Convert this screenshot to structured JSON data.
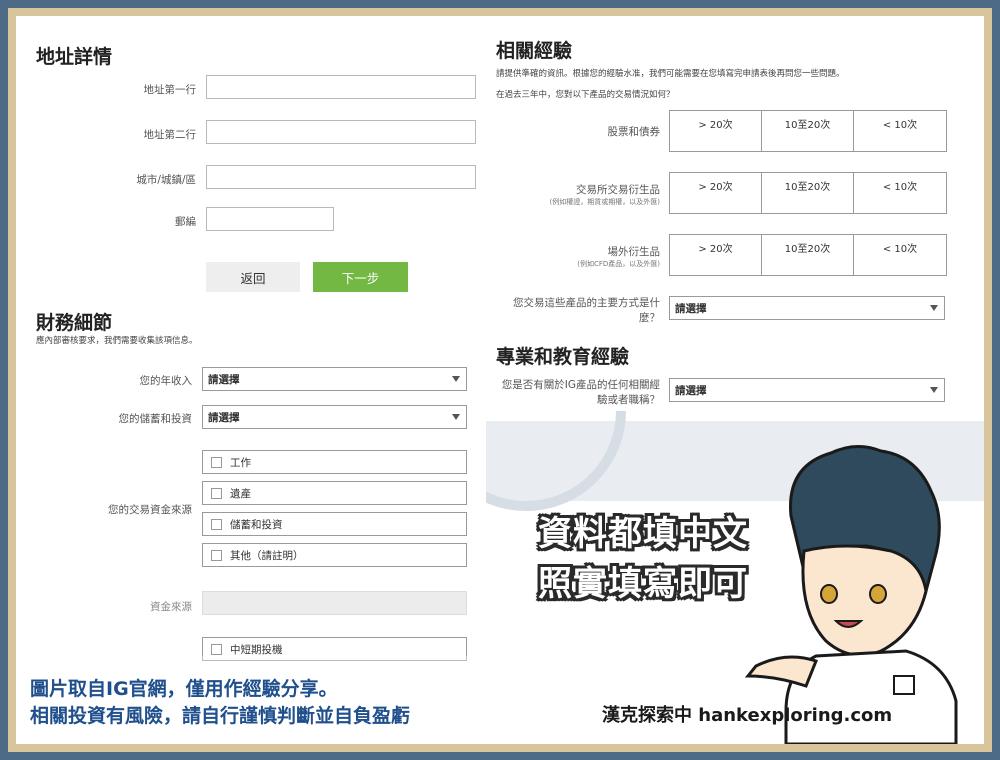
{
  "address": {
    "title": "地址詳情",
    "line1_label": "地址第一行",
    "line2_label": "地址第二行",
    "city_label": "城市/城鎮/區",
    "postcode_label": "郵編",
    "back_label": "返回",
    "next_label": "下一步"
  },
  "finance": {
    "title": "財務細節",
    "subtitle": "應內部審核要求，我們需要收集該項信息。",
    "income_label": "您的年收入",
    "income_value": "請選擇",
    "savings_label": "您的儲蓄和投資",
    "savings_value": "請選擇",
    "source_label": "您的交易資金來源",
    "source_options": [
      "工作",
      "遺產",
      "儲蓄和投資",
      "其他（請註明）"
    ],
    "source_other_label": "資金來源",
    "purpose_option": "中短期投機"
  },
  "experience": {
    "title": "相關經驗",
    "subtitle": "請提供準確的資訊。根據您的經驗水准，我們可能需要在您填寫完申請表後再問您一些問題。",
    "question": "在過去三年中，您對以下產品的交易情況如何？",
    "rows": [
      {
        "label": "股票和債券",
        "note": ""
      },
      {
        "label": "交易所交易衍生品",
        "note": "(例如權證，期貨或期權，以及外匯)"
      },
      {
        "label": "場外衍生品",
        "note": "(例如CFD產品，以及外匯)"
      }
    ],
    "freq_options": [
      "> 20次",
      "10至20次",
      "< 10次"
    ],
    "method_label": "您交易這些產品的主要方式是什麼？",
    "method_value": "請選擇"
  },
  "education": {
    "title": "專業和教育經驗",
    "question": "您是否有關於IG產品的任何相關經驗或者職稱？",
    "value": "請選擇"
  },
  "overlay": {
    "line1": "資料都填中文",
    "line2": "照實填寫即可",
    "footer_line1": "圖片取自IG官網，僅用作經驗分享。",
    "footer_line2": "相關投資有風險，請自行謹慎判斷並自負盈虧",
    "brand": "漢克探索中 hankexploring.com"
  },
  "colors": {
    "frame": "#4d6b86",
    "border": "#d9c59b",
    "next_button": "#73b843",
    "footer_text": "#1f4f8c"
  }
}
